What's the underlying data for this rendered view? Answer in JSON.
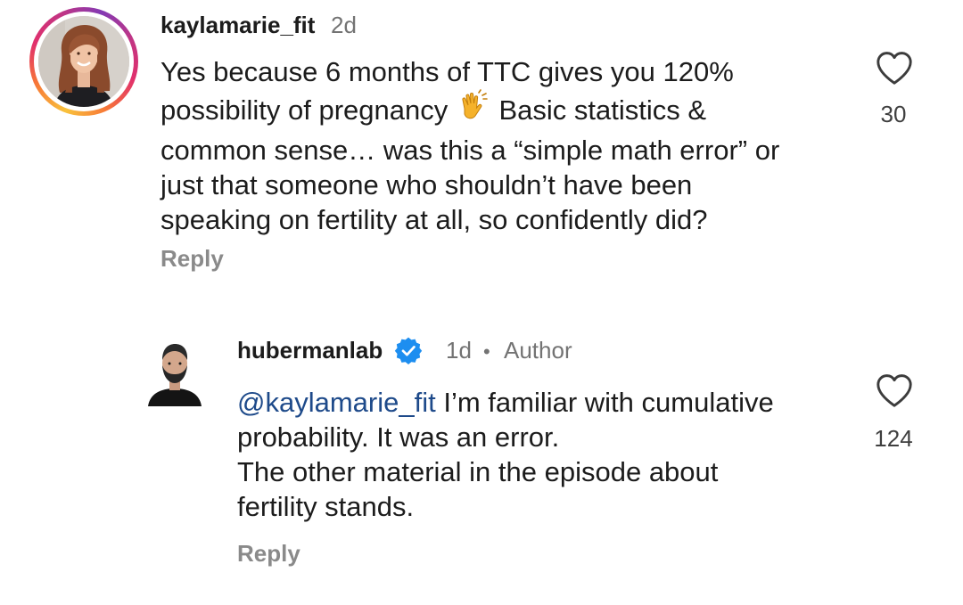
{
  "comments": [
    {
      "username": "kaylamarie_fit",
      "time": "2d",
      "lines": [
        "Yes because 6 months of TTC gives you 120%",
        "possibility of pregnancy",
        "Basic statistics &",
        "common sense… was this a “simple math error” or",
        "just that someone who shouldn’t have been",
        "speaking on fertility at all, so confidently did?"
      ],
      "emoji": "clapping-hands",
      "like_count": "30",
      "reply_label": "Reply"
    },
    {
      "username": "hubermanlab",
      "time": "1d",
      "separator": "•",
      "badge": "Author",
      "mention": "@kaylamarie_fit",
      "lines": [
        " I’m familiar with cumulative",
        "probability. It was an error.",
        "The other material in the episode about",
        "fertility stands."
      ],
      "like_count": "124",
      "reply_label": "Reply",
      "verified": true
    }
  ],
  "colors": {
    "text": "#1c1c1c",
    "meta": "#737373",
    "mention": "#1e4a8a",
    "verified": "#0095f6",
    "reply": "#8a8a8a"
  },
  "icons": {
    "like": "heart-outline-icon",
    "verified": "verified-badge-icon"
  }
}
